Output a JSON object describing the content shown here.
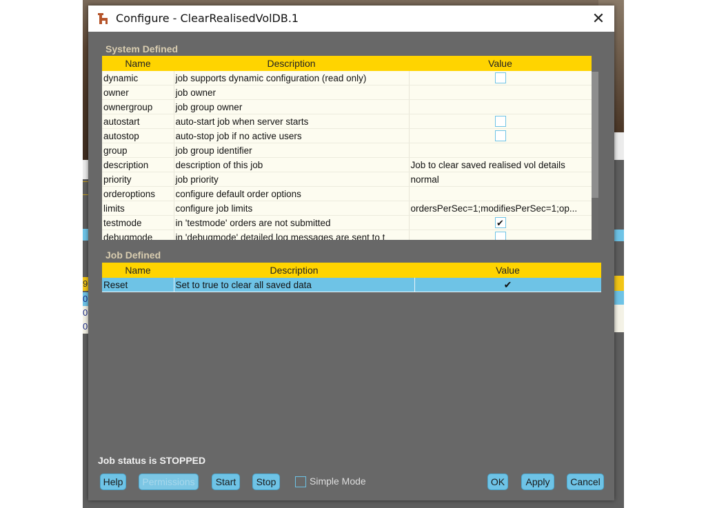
{
  "window": {
    "title": "Configure - ClearRealisedVolDB.1",
    "close_label": "✕"
  },
  "background": {
    "partial_rows": [
      "9",
      "0",
      "0",
      "0"
    ]
  },
  "system_defined": {
    "label": "System Defined",
    "columns": [
      "Name",
      "Description",
      "Value"
    ],
    "rows": [
      {
        "name": "dynamic",
        "description": "job supports dynamic configuration (read only)",
        "value_type": "checkbox",
        "checked": false,
        "value": ""
      },
      {
        "name": "owner",
        "description": "job owner",
        "value_type": "text",
        "value": ""
      },
      {
        "name": "ownergroup",
        "description": "job group owner",
        "value_type": "text",
        "value": ""
      },
      {
        "name": "autostart",
        "description": "auto-start job when server starts",
        "value_type": "checkbox",
        "checked": false,
        "value": ""
      },
      {
        "name": "autostop",
        "description": "auto-stop job if no active users",
        "value_type": "checkbox",
        "checked": false,
        "value": ""
      },
      {
        "name": "group",
        "description": "job group identifier",
        "value_type": "text",
        "value": ""
      },
      {
        "name": "description",
        "description": "description of this job",
        "value_type": "text",
        "value": "Job to clear saved realised vol details"
      },
      {
        "name": "priority",
        "description": "job priority",
        "value_type": "text",
        "value": "normal"
      },
      {
        "name": "orderoptions",
        "description": "configure default order options",
        "value_type": "text",
        "value": ""
      },
      {
        "name": "limits",
        "description": "configure job limits",
        "value_type": "text",
        "value": "ordersPerSec=1;modifiesPerSec=1;op..."
      },
      {
        "name": "testmode",
        "description": "in 'testmode' orders are not submitted",
        "value_type": "checkbox",
        "checked": true,
        "value": "✔"
      },
      {
        "name": "debugmode",
        "description": "in 'debugmode' detailed log messages are sent to t",
        "value_type": "checkbox",
        "checked": false,
        "value": ""
      }
    ]
  },
  "job_defined": {
    "label": "Job Defined",
    "columns": [
      "Name",
      "Description",
      "Value"
    ],
    "rows": [
      {
        "name": "Reset",
        "description": "Set to true to clear all saved data",
        "value": "✔",
        "checked": true
      }
    ]
  },
  "footer": {
    "status": "Job status is STOPPED",
    "buttons": {
      "help": "Help",
      "permissions": "Permissions",
      "start": "Start",
      "stop": "Stop",
      "ok": "OK",
      "apply": "Apply",
      "cancel": "Cancel"
    },
    "simple_mode_label": "Simple Mode",
    "simple_mode_checked": false
  },
  "colors": {
    "header_yellow": "#ffd400",
    "selection_blue": "#6ec3e6",
    "dialog_gray": "#686868",
    "section_label": "#d9cdb0"
  }
}
